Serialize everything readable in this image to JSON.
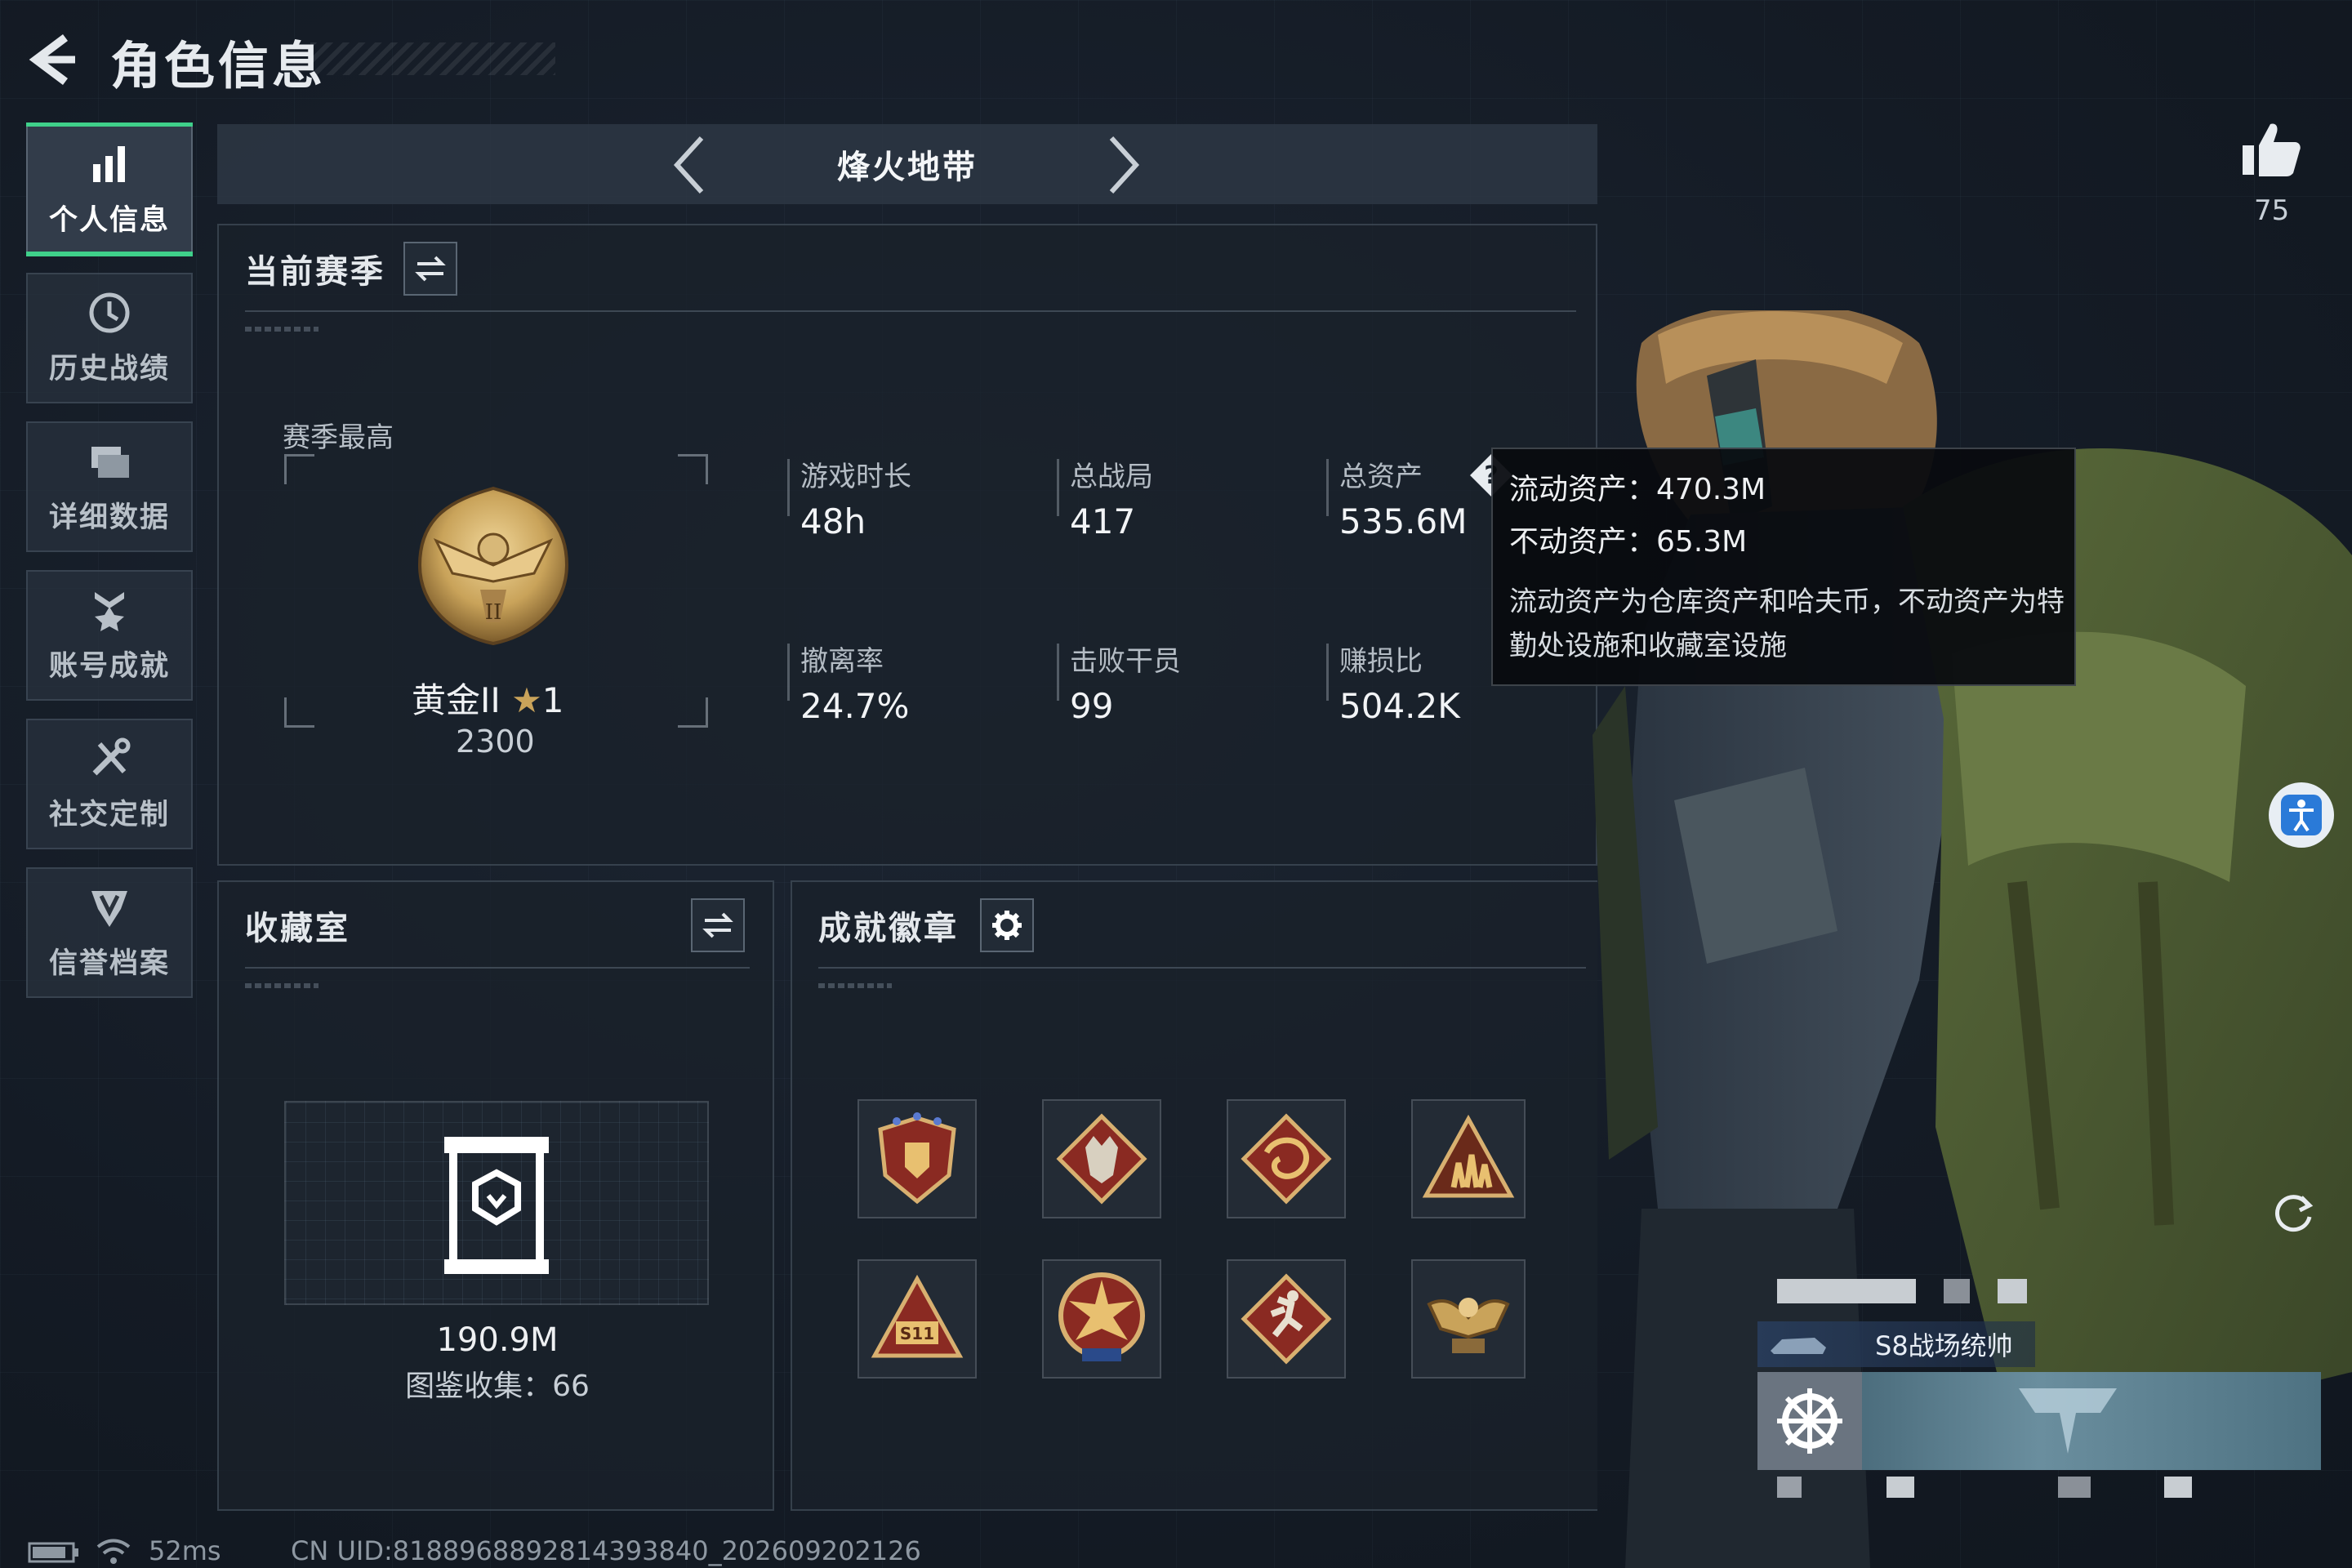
{
  "header": {
    "title": "角色信息"
  },
  "sidenav": {
    "items": [
      {
        "label": "个人信息",
        "icon": "bar-chart-icon",
        "active": true
      },
      {
        "label": "历史战绩",
        "icon": "clock-icon",
        "active": false
      },
      {
        "label": "详细数据",
        "icon": "folder-icon",
        "active": false
      },
      {
        "label": "账号成就",
        "icon": "medal-icon",
        "active": false
      },
      {
        "label": "社交定制",
        "icon": "tools-icon",
        "active": false
      },
      {
        "label": "信誉档案",
        "icon": "shield-icon",
        "active": false
      }
    ]
  },
  "mode": {
    "title": "烽火地带"
  },
  "season": {
    "title": "当前赛季",
    "best_label": "赛季最高",
    "rank_name": "黄金II",
    "rank_stars": "1",
    "rank_score": "2300",
    "stats": [
      {
        "label": "游戏时长",
        "value": "48h"
      },
      {
        "label": "总战局",
        "value": "417"
      },
      {
        "label": "总资产",
        "value": "535.6M"
      },
      {
        "label": "撤离率",
        "value": "24.7%"
      },
      {
        "label": "击败干员",
        "value": "99"
      },
      {
        "label": "赚损比",
        "value": "504.2K"
      }
    ]
  },
  "tooltip": {
    "liquid": "流动资产：470.3M",
    "fixed": "不动资产：65.3M",
    "desc": "流动资产为仓库资产和哈夫币，不动资产为特勤处设施和收藏室设施"
  },
  "collection": {
    "title": "收藏室",
    "value": "190.9M",
    "catalog": "图鉴收集：66"
  },
  "badges": {
    "title": "成就徽章",
    "items": [
      "shield-badge-icon",
      "wolf-badge-icon",
      "dragon-badge-icon",
      "team-badge-icon",
      "s11-badge-icon",
      "tank-badge-icon",
      "runner-badge-icon",
      "eagle-badge-icon"
    ]
  },
  "social": {
    "likes": "75"
  },
  "player": {
    "title_card": "S8战场统帅"
  },
  "footer": {
    "ping": "52ms",
    "uid": "CN UID:8188968892814393840_202609202126"
  },
  "colors": {
    "accent": "#3fd08a",
    "gold": "#c9a35a",
    "badge_red": "#8a2a22"
  }
}
